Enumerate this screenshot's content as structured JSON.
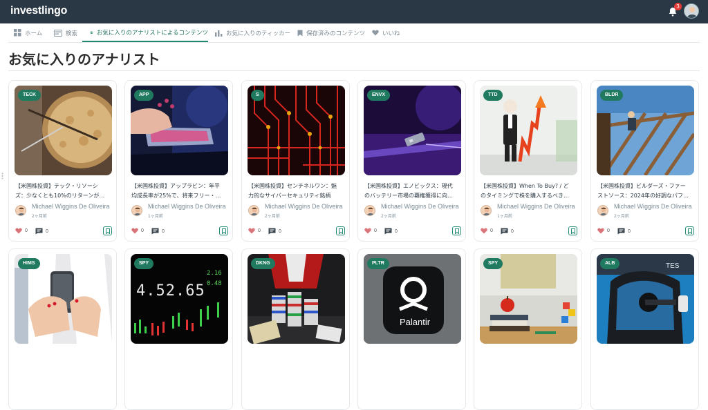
{
  "app": {
    "logo_text": "investlingo",
    "notification_count": "3",
    "accent": "#1f8a70"
  },
  "tabs": [
    {
      "label": "ホーム",
      "icon": "grid-icon"
    },
    {
      "label": "検索",
      "icon": "search-box-icon"
    },
    {
      "label": "お気に入りのアナリストによるコンテンツ",
      "icon": "people-icon",
      "active": true
    },
    {
      "label": "お気に入りのティッカー",
      "icon": "bar-chart-icon"
    },
    {
      "label": "保存済みのコンテンツ",
      "icon": "bookmark-icon"
    },
    {
      "label": "いいね",
      "icon": "heart-icon"
    }
  ],
  "page": {
    "title": "お気に入りのアナリスト"
  },
  "cards": [
    {
      "ticker": "TECK",
      "line1": "【米国株投資】テック・リソーシ",
      "line2": "ズ：少なくとも10%のリターンが…",
      "author": "Michael Wiggins De Oliveira",
      "date": "2ヶ月前",
      "likes": "0",
      "comments": "0"
    },
    {
      "ticker": "APP",
      "line1": "【米国株投資】アップラビン：年平",
      "line2": "均成長率が25%で、将来フリー・…",
      "author": "Michael Wiggins De Oliveira",
      "date": "1ヶ月前",
      "likes": "0",
      "comments": "0"
    },
    {
      "ticker": "S",
      "line1": "【米国株投資】センチネルワン：魅",
      "line2": "力的なサイバーセキュリティ銘柄",
      "author": "Michael Wiggins De Oliveira",
      "date": "2ヶ月前",
      "likes": "0",
      "comments": "0"
    },
    {
      "ticker": "ENVX",
      "line1": "【米国株投資】エノビックス：現代",
      "line2": "のバッテリー市場の覇権獲得に向…",
      "author": "Michael Wiggins De Oliveira",
      "date": "2ヶ月前",
      "likes": "0",
      "comments": "0"
    },
    {
      "ticker": "TTD",
      "line1": "【米国株投資】When To Buy? / ど",
      "line2": "のタイミングで株を購入するべき…",
      "author": "Michael Wiggins De Oliveira",
      "date": "1ヶ月前",
      "likes": "0",
      "comments": "0"
    },
    {
      "ticker": "BLDR",
      "line1": "【米国株投資】ビルダーズ・ファー",
      "line2": "ストソース：2024年の好調なパフ…",
      "author": "Michael Wiggins De Oliveira",
      "date": "2ヶ月前",
      "likes": "0",
      "comments": "0"
    },
    {
      "ticker": "HIMS"
    },
    {
      "ticker": "SPY"
    },
    {
      "ticker": "DKNG"
    },
    {
      "ticker": "PLTR"
    },
    {
      "ticker": "SPY"
    },
    {
      "ticker": "ALB"
    }
  ],
  "thumb_texts": {
    "spy_board": "4.52.65",
    "palantir": "Palantir"
  }
}
